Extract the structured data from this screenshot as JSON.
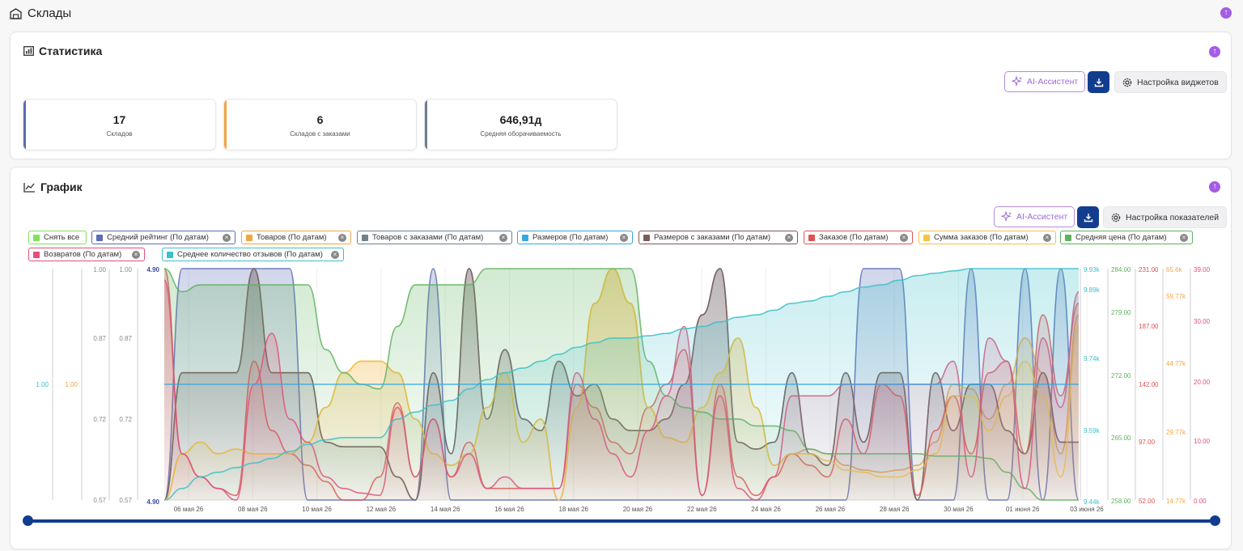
{
  "page": {
    "title": "Склады"
  },
  "stats_card": {
    "title": "Статистика",
    "ai_button": "AI-Ассистент",
    "settings_button": "Настройка виджетов",
    "stats": [
      {
        "value": "17",
        "label": "Складов",
        "color": "#5b6bb5"
      },
      {
        "value": "6",
        "label": "Складов с заказами",
        "color": "#f0a742"
      },
      {
        "value": "646,91д",
        "label": "Средняя оборачиваемость",
        "color": "#6e7f8d"
      }
    ]
  },
  "chart_card": {
    "title": "График",
    "ai_button": "AI-Ассистент",
    "settings_button": "Настройка показателей",
    "legend": [
      {
        "label": "Снять все",
        "color": "#7ee35a",
        "removable": false
      },
      {
        "label": "Средний рейтинг (По датам)",
        "color": "#5b6bb5",
        "removable": true
      },
      {
        "label": "Товаров (По датам)",
        "color": "#f0a742",
        "removable": true
      },
      {
        "label": "Товаров с заказами (По датам)",
        "color": "#6e7f8d",
        "removable": true
      },
      {
        "label": "Размеров (По датам)",
        "color": "#35a8e0",
        "removable": true
      },
      {
        "label": "Размеров с заказами (По датам)",
        "color": "#7a5c58",
        "removable": true
      },
      {
        "label": "Заказов (По датам)",
        "color": "#e05252",
        "removable": true
      },
      {
        "label": "Сумма заказов (По датам)",
        "color": "#f5c342",
        "removable": true
      },
      {
        "label": "Средняя цена (По датам)",
        "color": "#5fb35f",
        "removable": true
      },
      {
        "label": "Возвратов (По датам)",
        "color": "#e0507a",
        "removable": true
      },
      {
        "label": "Среднее количество отзывов (По датам)",
        "color": "#3cbfc9",
        "removable": true
      }
    ]
  },
  "chart_data": {
    "type": "line",
    "x": [
      "06 мая 26",
      "08 мая 26",
      "10 мая 26",
      "12 мая 26",
      "14 мая 26",
      "16 мая 26",
      "18 мая 26",
      "20 мая 26",
      "22 мая 26",
      "24 мая 26",
      "26 мая 26",
      "28 мая 26",
      "30 мая 26",
      "01 июня 26",
      "03 июня 26"
    ],
    "left_axes": [
      {
        "labels": [
          "1.00"
        ],
        "color": "#3cbfc9"
      },
      {
        "labels": [
          "1.00"
        ],
        "color": "#f0a742"
      },
      {
        "labels": [
          "1.00",
          "0.87",
          "0.72",
          "0.57"
        ],
        "color": "#888888"
      },
      {
        "labels": [
          "1.00",
          "0.87",
          "0.72",
          "0.57"
        ],
        "color": "#888888"
      },
      {
        "labels": [
          "4.90",
          "4.90"
        ],
        "color": "#3f4b9a"
      }
    ],
    "right_axes": [
      {
        "labels": [
          "9.93k",
          "9.89k",
          "9.74k",
          "9.59k",
          "9.44k"
        ],
        "color": "#3cbfc9"
      },
      {
        "labels": [
          "284.00",
          "279.00",
          "272.00",
          "265.00",
          "258.00"
        ],
        "color": "#5fb35f"
      },
      {
        "labels": [
          "231.00",
          "187.00",
          "142.00",
          "97.00",
          "52.00"
        ],
        "color": "#e05252"
      },
      {
        "labels": [
          "65.6k",
          "59.77k",
          "44.77k",
          "29.77k",
          "14.77k"
        ],
        "color": "#f5a742"
      },
      {
        "labels": [
          "39.00",
          "30.00",
          "20.00",
          "10.00",
          "0.00"
        ],
        "color": "#e0507a"
      }
    ],
    "series": [
      {
        "name": "Средний рейтинг (По датам)",
        "color": "#5b6bb5",
        "values": [
          0.0,
          1.0,
          1.0,
          1.0,
          1.0,
          1.0,
          1.0,
          1.0,
          0.0,
          0.0,
          0.0,
          0.0,
          0.0,
          0.0,
          0.0,
          1.0,
          0.0,
          0.0,
          0.0,
          0.0,
          0.0,
          0.0,
          0.0,
          0.0,
          0.0,
          0.0,
          0.0,
          0.0,
          0.0,
          0.0,
          0.0,
          0.0,
          0.0,
          0.0,
          0.0,
          0.0,
          0.0,
          0.0,
          0.0,
          1.0,
          1.0,
          1.0,
          0.0,
          0.0,
          0.0,
          1.0,
          0.0,
          0.0,
          1.0,
          0.0,
          1.0,
          0.0
        ]
      },
      {
        "name": "Товаров (По датам)",
        "color": "#f0a742",
        "values": [
          0.0,
          0.2,
          0.25,
          0.2,
          0.22,
          0.2,
          0.2,
          0.2,
          0.25,
          0.4,
          0.55,
          0.6,
          0.6,
          0.55,
          0.35,
          0.2,
          0.15,
          0.2,
          0.4,
          0.55,
          0.25,
          0.35,
          0.0,
          0.4,
          0.85,
          1.0,
          0.85,
          0.4,
          0.27,
          0.25,
          0.4,
          0.55,
          0.7,
          0.4,
          0.15,
          0.2,
          0.22,
          0.2,
          0.15,
          0.13,
          0.12,
          0.13,
          0.15,
          0.25,
          0.5,
          0.48,
          0.35,
          0.5,
          0.7,
          0.55,
          0.2,
          0.8
        ]
      },
      {
        "name": "Товаров с заказами (По датам)",
        "color": "#6e7f8d",
        "values": [
          0.0,
          0.55,
          0.55,
          0.55,
          0.55,
          1.0,
          0.55,
          0.55,
          0.55,
          0.25,
          0.23,
          0.23,
          0.23,
          0.1,
          0.0,
          0.55,
          0.2,
          1.0,
          0.35,
          0.65,
          0.35,
          0.3,
          0.6,
          0.45,
          0.5,
          0.35,
          0.3,
          0.3,
          0.35,
          0.5,
          0.8,
          1.0,
          0.25,
          0.22,
          0.25,
          0.55,
          0.2,
          0.15,
          0.55,
          0.25,
          0.55,
          0.55,
          0.0,
          0.55,
          0.3,
          0.5,
          0.5,
          0.3,
          0.2,
          0.55,
          0.25,
          0.25
        ]
      },
      {
        "name": "Размеров с заказами (По датам)",
        "color": "#7a5c58",
        "values": [
          0.0,
          0.55,
          0.55,
          0.55,
          0.55,
          1.0,
          0.55,
          0.55,
          0.55,
          0.25,
          0.23,
          0.23,
          0.23,
          0.1,
          0.0,
          0.55,
          0.2,
          1.0,
          0.35,
          0.65,
          0.35,
          0.3,
          0.6,
          0.45,
          0.5,
          0.35,
          0.3,
          0.3,
          0.35,
          0.5,
          0.8,
          1.0,
          0.25,
          0.22,
          0.25,
          0.55,
          0.2,
          0.15,
          0.55,
          0.25,
          0.55,
          0.55,
          0.0,
          0.55,
          0.3,
          0.5,
          0.5,
          0.3,
          0.2,
          0.55,
          0.25,
          0.25
        ]
      },
      {
        "name": "Заказов (По датам)",
        "color": "#e05252",
        "values": [
          1.0,
          0.2,
          0.1,
          0.05,
          0.02,
          0.6,
          0.3,
          0.2,
          0.15,
          0.08,
          0.0,
          0.0,
          0.1,
          0.42,
          0.1,
          0.35,
          0.1,
          0.25,
          0.05,
          0.05,
          0.05,
          0.05,
          0.05,
          0.5,
          0.4,
          0.25,
          0.2,
          0.4,
          0.5,
          0.65,
          0.02,
          0.5,
          0.1,
          0.02,
          0.1,
          0.2,
          0.15,
          0.1,
          0.35,
          0.2,
          0.5,
          0.45,
          0.02,
          0.3,
          0.45,
          0.2,
          0.55,
          0.6,
          0.2,
          0.8,
          0.45,
          0.85
        ]
      },
      {
        "name": "Сумма заказов (По датам)",
        "color": "#f5c342",
        "values": [
          0.0,
          0.2,
          0.25,
          0.2,
          0.22,
          0.2,
          0.2,
          0.2,
          0.25,
          0.4,
          0.55,
          0.6,
          0.6,
          0.55,
          0.35,
          0.2,
          0.15,
          0.2,
          0.4,
          0.55,
          0.25,
          0.35,
          0.0,
          0.4,
          0.85,
          1.0,
          0.85,
          0.4,
          0.27,
          0.25,
          0.4,
          0.55,
          0.7,
          0.4,
          0.15,
          0.2,
          0.2,
          0.17,
          0.13,
          0.12,
          0.1,
          0.1,
          0.13,
          0.2,
          0.45,
          0.45,
          0.3,
          0.45,
          0.6,
          0.45,
          0.1,
          0.75
        ]
      },
      {
        "name": "Средняя цена (По датам)",
        "color": "#5fb35f",
        "values": [
          1.0,
          0.9,
          0.93,
          0.93,
          0.93,
          0.93,
          0.93,
          0.93,
          0.93,
          0.65,
          0.55,
          0.5,
          0.48,
          0.75,
          0.93,
          0.93,
          0.93,
          0.93,
          1.0,
          1.0,
          1.0,
          1.0,
          1.0,
          1.0,
          1.0,
          1.0,
          1.0,
          0.6,
          0.45,
          0.4,
          0.38,
          0.35,
          0.35,
          0.32,
          0.32,
          0.3,
          0.22,
          0.2,
          0.2,
          0.2,
          0.2,
          0.2,
          0.2,
          0.19,
          0.19,
          0.19,
          0.18,
          0.12,
          0.05,
          0.0,
          0.0,
          0.0
        ]
      },
      {
        "name": "Возвратов (По датам)",
        "color": "#e0507a",
        "values": [
          0.95,
          0.2,
          0.1,
          0.05,
          0.0,
          0.5,
          0.72,
          0.35,
          0.25,
          0.1,
          0.05,
          0.03,
          0.02,
          0.4,
          0.1,
          0.35,
          0.1,
          0.2,
          0.05,
          0.1,
          0.05,
          0.05,
          0.05,
          0.55,
          0.35,
          0.2,
          0.1,
          0.3,
          0.45,
          0.75,
          0.02,
          0.45,
          0.05,
          0.0,
          0.1,
          0.45,
          0.45,
          0.45,
          0.5,
          0.5,
          0.5,
          0.5,
          0.5,
          0.5,
          0.6,
          0.1,
          0.7,
          0.6,
          0.05,
          0.7,
          0.4,
          0.9
        ]
      },
      {
        "name": "Среднее количество отзывов (По датам)",
        "color": "#3cbfc9",
        "values": [
          0.0,
          0.05,
          0.1,
          0.12,
          0.14,
          0.16,
          0.18,
          0.21,
          0.24,
          0.26,
          0.27,
          0.27,
          0.27,
          0.35,
          0.38,
          0.41,
          0.43,
          0.48,
          0.52,
          0.55,
          0.57,
          0.6,
          0.63,
          0.66,
          0.68,
          0.7,
          0.7,
          0.71,
          0.72,
          0.74,
          0.75,
          0.77,
          0.79,
          0.8,
          0.82,
          0.85,
          0.86,
          0.88,
          0.9,
          0.92,
          0.93,
          0.95,
          0.97,
          0.98,
          0.99,
          1.0,
          1.0,
          1.0,
          1.0,
          1.0,
          1.0,
          1.0
        ]
      },
      {
        "name": "Размеров (По датам)",
        "color": "#35a8e0",
        "values": [
          0.5,
          0.5,
          0.5,
          0.5,
          0.5,
          0.5,
          0.5,
          0.5,
          0.5,
          0.5,
          0.5,
          0.5,
          0.5,
          0.5,
          0.5,
          0.5,
          0.5,
          0.5,
          0.5,
          0.5,
          0.5,
          0.5,
          0.5,
          0.5,
          0.5,
          0.5,
          0.5,
          0.5,
          0.5,
          0.5,
          0.5,
          0.5,
          0.5,
          0.5,
          0.5,
          0.5,
          0.5,
          0.5,
          0.5,
          0.5,
          0.5,
          0.5,
          0.5,
          0.5,
          0.5,
          0.5,
          0.5,
          0.5,
          0.5,
          0.5,
          0.5,
          0.5
        ]
      }
    ]
  }
}
